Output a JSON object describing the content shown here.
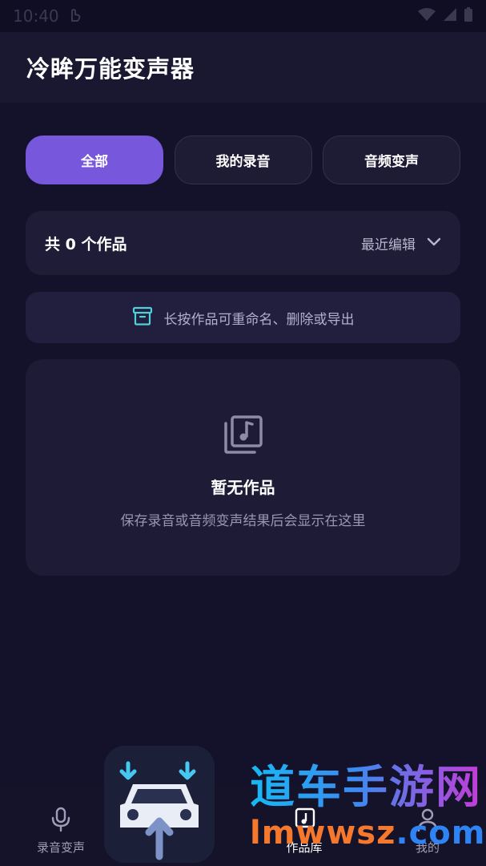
{
  "status_bar": {
    "time": "10:40"
  },
  "header": {
    "title": "冷眸万能变声器"
  },
  "tabs": [
    {
      "label": "全部",
      "active": true
    },
    {
      "label": "我的录音",
      "active": false
    },
    {
      "label": "音频变声",
      "active": false
    }
  ],
  "summary": {
    "count_text": "共 0 个作品",
    "sort_label": "最近编辑"
  },
  "tip": {
    "text": "长按作品可重命名、删除或导出"
  },
  "empty_state": {
    "title": "暂无作品",
    "description": "保存录音或音频变声结果后会显示在这里"
  },
  "bottom_nav": [
    {
      "label": "录音变声",
      "active": false
    },
    {
      "label": "作品库",
      "active": true
    },
    {
      "label": "我的",
      "active": false
    }
  ],
  "watermark": {
    "name": "道车手游网",
    "url_part1": "lmwwsz",
    "url_part2": ".com"
  },
  "colors": {
    "background": "#14122a",
    "accent": "#7757dc",
    "card": "#1e1b36",
    "tip_icon": "#4fd1d9"
  }
}
